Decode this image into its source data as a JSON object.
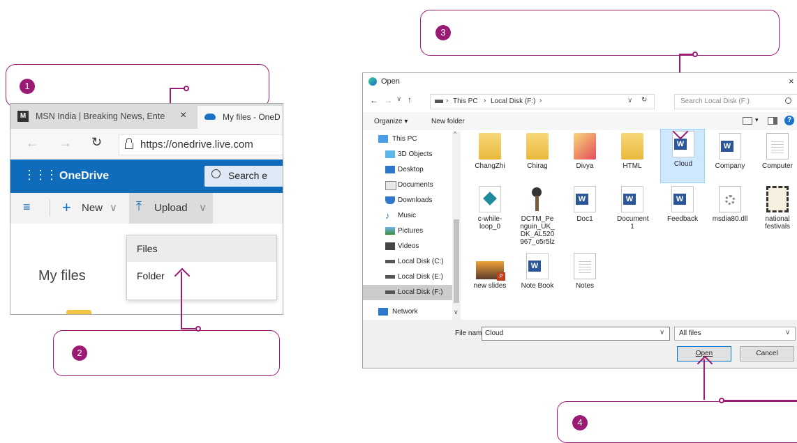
{
  "callouts": {
    "c1": "1",
    "c2": "2",
    "c3": "3",
    "c4": "4"
  },
  "browser": {
    "tab1_title": "MSN India | Breaking News, Ente",
    "tab1_close": "×",
    "tab2_title": "My files - OneD",
    "url": "https://onedrive.live.com",
    "app_name": "OneDrive",
    "search_placeholder": "Search e",
    "new_label": "New",
    "upload_label": "Upload",
    "page_title": "My files",
    "menu": {
      "files": "Files",
      "folder": "Folder"
    }
  },
  "dialog": {
    "title": "Open",
    "breadcrumb": [
      "This PC",
      "Local Disk (F:)"
    ],
    "search_placeholder": "Search Local Disk (F:)",
    "organize_label": "Organize ▾",
    "new_folder_label": "New folder",
    "nav_items": [
      "This PC",
      "3D Objects",
      "Desktop",
      "Documents",
      "Downloads",
      "Music",
      "Pictures",
      "Videos",
      "Local Disk (C:)",
      "Local Disk (E:)",
      "Local Disk (F:)",
      "Network"
    ],
    "files": [
      {
        "name": "ChangZhi",
        "kind": "folder"
      },
      {
        "name": "Chirag",
        "kind": "folder"
      },
      {
        "name": "Divya",
        "kind": "folder"
      },
      {
        "name": "HTML",
        "kind": "folder"
      },
      {
        "name": "Cloud",
        "kind": "word"
      },
      {
        "name": "Company",
        "kind": "word"
      },
      {
        "name": "Computer",
        "kind": "text"
      },
      {
        "name": "c-while-loop_0",
        "kind": "image"
      },
      {
        "name": "DCTM_Penguin_UK_DK_AL520967_o5r5lz",
        "kind": "image"
      },
      {
        "name": "Doc1",
        "kind": "word"
      },
      {
        "name": "Document 1",
        "kind": "word"
      },
      {
        "name": "Feedback",
        "kind": "word"
      },
      {
        "name": "msdia80.dll",
        "kind": "dll"
      },
      {
        "name": "national festivals",
        "kind": "video"
      },
      {
        "name": "new slides",
        "kind": "ppt"
      },
      {
        "name": "Note Book",
        "kind": "word"
      },
      {
        "name": "Notes",
        "kind": "text"
      }
    ],
    "file_name_label": "File name:",
    "file_name_value": "Cloud",
    "file_type": "All files",
    "open_label": "Open",
    "cancel_label": "Cancel"
  },
  "colors": {
    "accent": "#9b1a74",
    "onedrive_blue": "#0f6cbd",
    "selection": "#cde8ff"
  }
}
